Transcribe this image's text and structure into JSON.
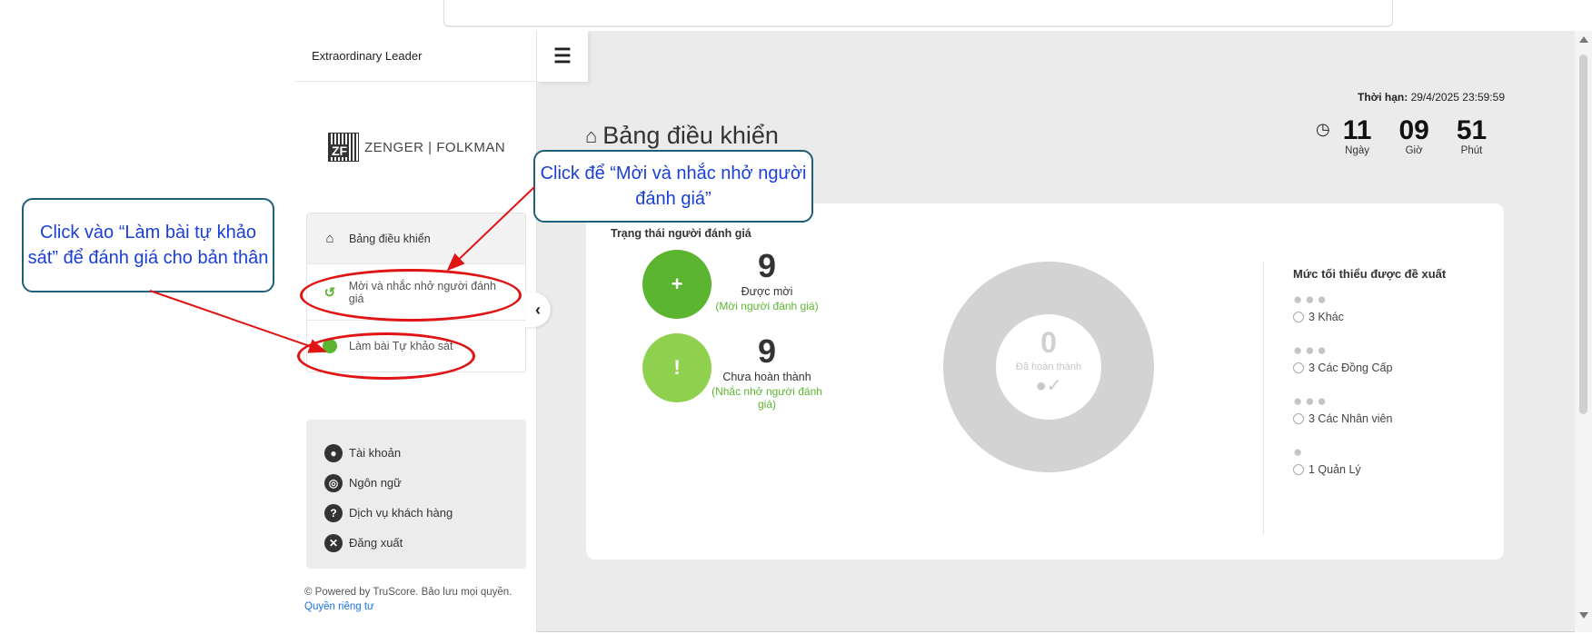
{
  "app": {
    "title": "Extraordinary Leader"
  },
  "logo": {
    "mark": "ZF",
    "text": "ZENGER | FOLKMAN"
  },
  "sidebar": {
    "items": [
      {
        "icon": "home-icon",
        "label": "Bảng điều khiển"
      },
      {
        "icon": "history-icon",
        "label": "Mời và nhắc nhở người đánh giá"
      },
      {
        "icon": "green-dot-icon",
        "label": "Làm bài Tự khảo sát"
      }
    ],
    "account": [
      {
        "icon": "user-icon",
        "label": "Tài khoản"
      },
      {
        "icon": "globe-icon",
        "label": "Ngôn ngữ"
      },
      {
        "icon": "question-icon",
        "label": "Dịch vụ khách hàng"
      },
      {
        "icon": "close-icon",
        "label": "Đăng xuất"
      }
    ],
    "footer_text": "© Powered by TruScore. Bảo lưu mọi quyền.",
    "footer_link": "Quyền riêng tư"
  },
  "header": {
    "title": "Bảng điều khiển",
    "deadline_label": "Thời hạn:",
    "deadline_value": "29/4/2025 23:59:59",
    "countdown": [
      {
        "value": "11",
        "label": "Ngày"
      },
      {
        "value": "09",
        "label": "Giờ"
      },
      {
        "value": "51",
        "label": "Phút"
      }
    ]
  },
  "status": {
    "title": "Trạng thái người đánh giá",
    "invited": {
      "count": "9",
      "label": "Được mời",
      "link": "(Mời người đánh giá)"
    },
    "incomplete": {
      "count": "9",
      "label": "Chưa hoàn thành",
      "link": "(Nhắc nhở người đánh giá)"
    },
    "completed": {
      "count": "0",
      "label": "Đã hoàn thành"
    }
  },
  "minimum": {
    "title": "Mức tối thiểu được đề xuất",
    "rows": [
      {
        "people": 3,
        "label": "3 Khác"
      },
      {
        "people": 3,
        "label": "3 Các Đồng Cấp"
      },
      {
        "people": 3,
        "label": "3 Các Nhân viên"
      },
      {
        "people": 1,
        "label": "1 Quản Lý"
      }
    ]
  },
  "annotations": {
    "left": "Click vào “Làm bài tự khảo sát” để đánh giá cho bản thân",
    "top": "Click để “Mời và nhắc nhở người đánh giá”"
  },
  "colors": {
    "accent_green": "#5cb531",
    "light_green": "#8fd14f",
    "annotation_red": "#e01414",
    "annotation_border": "#1e5f7a",
    "annotation_text": "#1a3fd6"
  }
}
